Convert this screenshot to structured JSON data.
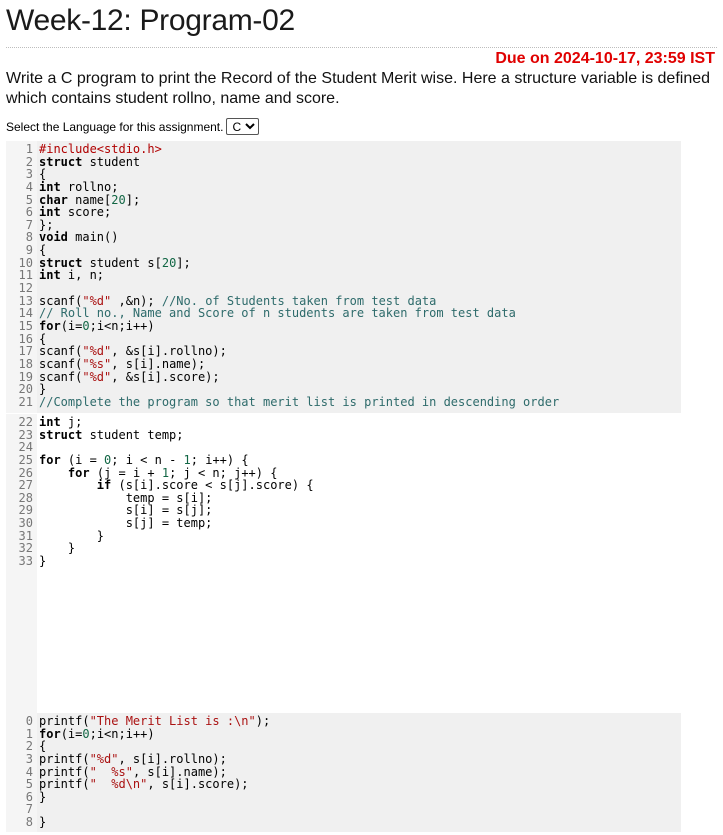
{
  "header": {
    "title": "Week-12: Program-02",
    "due": "Due on 2024-10-17, 23:59 IST"
  },
  "description": "Write a C program to print the Record of the Student Merit wise. Here a structure variable is defined which contains student rollno, name and score.",
  "language": {
    "label": "Select the Language for this assignment.",
    "selected": "C"
  },
  "prefix_code": {
    "lines": [
      {
        "n": "1",
        "t": "#include<stdio.h>"
      },
      {
        "n": "2",
        "t": "struct student"
      },
      {
        "n": "3",
        "t": "{"
      },
      {
        "n": "4",
        "t": "int rollno;"
      },
      {
        "n": "5",
        "t": "char name[20];"
      },
      {
        "n": "6",
        "t": "int score;"
      },
      {
        "n": "7",
        "t": "};"
      },
      {
        "n": "8",
        "t": "void main()"
      },
      {
        "n": "9",
        "t": "{"
      },
      {
        "n": "10",
        "t": "struct student s[20];"
      },
      {
        "n": "11",
        "t": "int i, n;"
      },
      {
        "n": "12",
        "t": ""
      },
      {
        "n": "13",
        "t": "scanf(\"%d\" ,&n); //No. of Students taken from test data"
      },
      {
        "n": "14",
        "t": "// Roll no., Name and Score of n students are taken from test data"
      },
      {
        "n": "15",
        "t": "for(i=0;i<n;i++)"
      },
      {
        "n": "16",
        "t": "{"
      },
      {
        "n": "17",
        "t": "scanf(\"%d\", &s[i].rollno);"
      },
      {
        "n": "18",
        "t": "scanf(\"%s\", s[i].name);"
      },
      {
        "n": "19",
        "t": "scanf(\"%d\", &s[i].score);"
      },
      {
        "n": "20",
        "t": "}"
      },
      {
        "n": "21",
        "t": "//Complete the program so that merit list is printed in descending order"
      }
    ]
  },
  "editor": {
    "lines": [
      {
        "n": "22",
        "t": "int j;"
      },
      {
        "n": "23",
        "t": "struct student temp;"
      },
      {
        "n": "24",
        "t": ""
      },
      {
        "n": "25",
        "t": "for (i = 0; i < n - 1; i++) {"
      },
      {
        "n": "26",
        "t": "    for (j = i + 1; j < n; j++) {"
      },
      {
        "n": "27",
        "t": "        if (s[i].score < s[j].score) {"
      },
      {
        "n": "28",
        "t": "            temp = s[i];"
      },
      {
        "n": "29",
        "t": "            s[i] = s[j];"
      },
      {
        "n": "30",
        "t": "            s[j] = temp;"
      },
      {
        "n": "31",
        "t": "        }"
      },
      {
        "n": "32",
        "t": "    }"
      },
      {
        "n": "33",
        "t": "}"
      }
    ]
  },
  "suffix_code": {
    "lines": [
      {
        "n": "0",
        "t": "printf(\"The Merit List is :\\n\");"
      },
      {
        "n": "1",
        "t": "for(i=0;i<n;i++)"
      },
      {
        "n": "2",
        "t": "{"
      },
      {
        "n": "3",
        "t": "printf(\"%d\", s[i].rollno);"
      },
      {
        "n": "4",
        "t": "printf(\"  %s\", s[i].name);"
      },
      {
        "n": "5",
        "t": "printf(\"  %d\\n\", s[i].score);"
      },
      {
        "n": "6",
        "t": "}"
      },
      {
        "n": "7",
        "t": ""
      },
      {
        "n": "8",
        "t": "}"
      }
    ]
  }
}
